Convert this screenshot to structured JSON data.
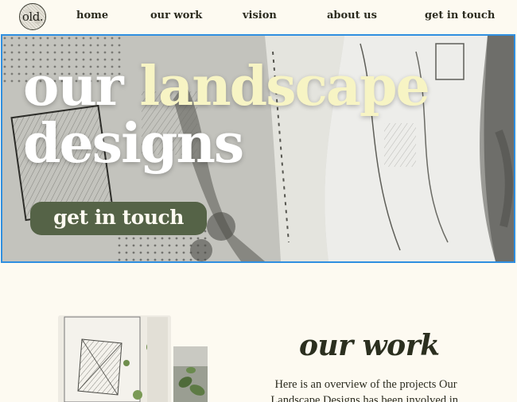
{
  "nav": {
    "logo_text": "old.",
    "items": [
      {
        "label": "home"
      },
      {
        "label": "our work"
      },
      {
        "label": "vision"
      },
      {
        "label": "about us"
      },
      {
        "label": "get in touch"
      }
    ]
  },
  "hero": {
    "title_word1": "our",
    "title_word2": "landscape",
    "title_word3": "designs",
    "cta_label": "get in touch"
  },
  "work": {
    "heading": "our work",
    "description": "Here is an overview of the projects Our Landscape Designs has been involved in."
  },
  "colors": {
    "background": "#fdfaf1",
    "accent_text": "#f7f4c4",
    "cta_green": "#556347",
    "focus_border": "#2f8fe0"
  }
}
